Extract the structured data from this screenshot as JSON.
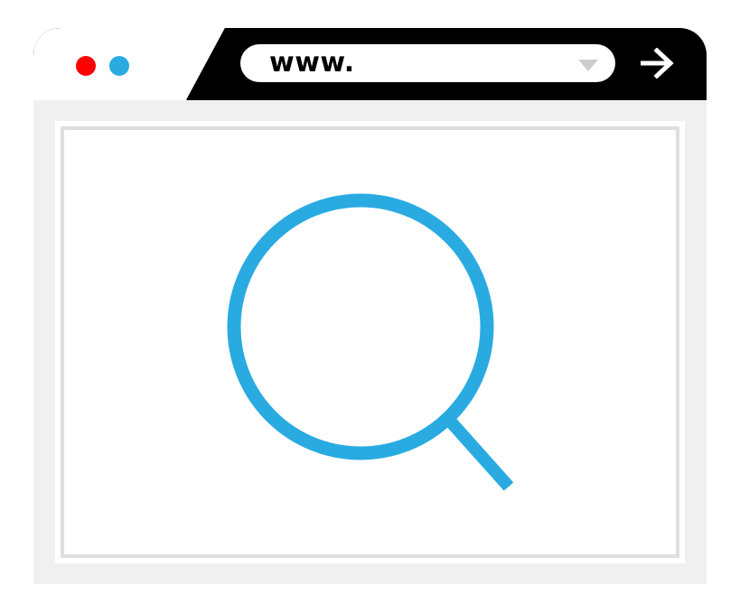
{
  "window": {
    "traffic_lights": [
      {
        "name": "close",
        "color": "#ff0000"
      },
      {
        "name": "minimize",
        "color": "#29abe2"
      }
    ],
    "chrome_color": "#000000",
    "content_background": "#f0f0f0",
    "frame_color": "#dedede"
  },
  "address_bar": {
    "value": "www.",
    "dropdown_icon": "triangle-down-icon",
    "go_icon": "arrow-right-icon"
  },
  "main": {
    "icon": "magnifying-glass-icon",
    "icon_color": "#29abe2"
  }
}
